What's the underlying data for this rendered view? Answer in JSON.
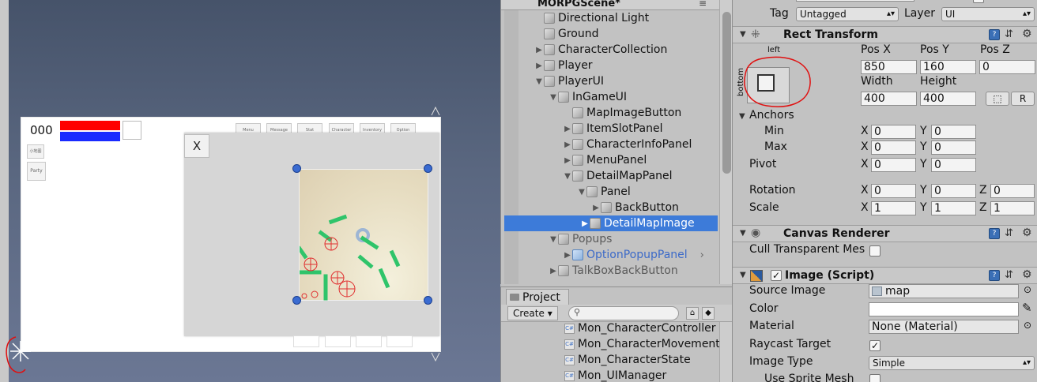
{
  "hierarchy": {
    "scene_title": "MORPGScene*",
    "menu_glyph": "≡",
    "rows": [
      {
        "label": "Directional Light"
      },
      {
        "label": "Ground"
      },
      {
        "label": "CharacterCollection"
      },
      {
        "label": "Player"
      },
      {
        "label": "PlayerUI"
      },
      {
        "label": "InGameUI"
      },
      {
        "label": "MapImageButton"
      },
      {
        "label": "ItemSlotPanel"
      },
      {
        "label": "CharacterInfoPanel"
      },
      {
        "label": "MenuPanel"
      },
      {
        "label": "DetailMapPanel"
      },
      {
        "label": "Panel"
      },
      {
        "label": "BackButton"
      },
      {
        "label": "DetailMapImage"
      },
      {
        "label": "Popups"
      },
      {
        "label": "OptionPopupPanel"
      },
      {
        "label": "TalkBoxBackButton"
      }
    ]
  },
  "project": {
    "tab_label": "Project",
    "create_label": "Create ▾",
    "search_placeholder": "",
    "files": [
      "Mon_CharacterController",
      "Mon_CharacterMovement",
      "Mon_CharacterState",
      "Mon_UIManager"
    ]
  },
  "scene": {
    "hud_number": "000",
    "left_btn_1": "小地图",
    "left_btn_2": "Party",
    "menu_buttons": [
      "Menu",
      "Message",
      "Stat",
      "Character",
      "Inventory",
      "Option"
    ],
    "back_button_label": "X",
    "colors": {
      "hp": "#ff0000",
      "mp": "#1a2bff",
      "selection": "#3d7bd9",
      "annotation": "#e01010"
    }
  },
  "inspector": {
    "tag_label": "Tag",
    "tag_value": "Untagged",
    "layer_label": "Layer",
    "layer_value": "UI",
    "rect_transform": {
      "title": "Rect Transform",
      "preset_top": "left",
      "preset_side": "bottom",
      "pos_x_label": "Pos X",
      "pos_y_label": "Pos Y",
      "pos_z_label": "Pos Z",
      "pos_x": "850",
      "pos_y": "160",
      "pos_z": "0",
      "width_label": "Width",
      "height_label": "Height",
      "width": "400",
      "height": "400",
      "r_button": "R",
      "anchors_label": "Anchors",
      "min_label": "Min",
      "max_label": "Max",
      "min_x": "0",
      "min_y": "0",
      "max_x": "0",
      "max_y": "0",
      "pivot_label": "Pivot",
      "pivot_x": "0",
      "pivot_y": "0",
      "rotation_label": "Rotation",
      "rot_x": "0",
      "rot_y": "0",
      "rot_z": "0",
      "scale_label": "Scale",
      "scale_x": "1",
      "scale_y": "1",
      "scale_z": "1",
      "x_label": "X",
      "y_label": "Y",
      "z_label": "Z"
    },
    "canvas_renderer": {
      "title": "Canvas Renderer",
      "cull_label": "Cull Transparent Mes"
    },
    "image": {
      "title": "Image (Script)",
      "source_label": "Source Image",
      "source_value": "map",
      "color_label": "Color",
      "material_label": "Material",
      "material_value": "None (Material)",
      "raycast_label": "Raycast Target",
      "image_type_label": "Image Type",
      "image_type_value": "Simple",
      "sprite_mesh_label": "Use Sprite Mesh"
    }
  }
}
